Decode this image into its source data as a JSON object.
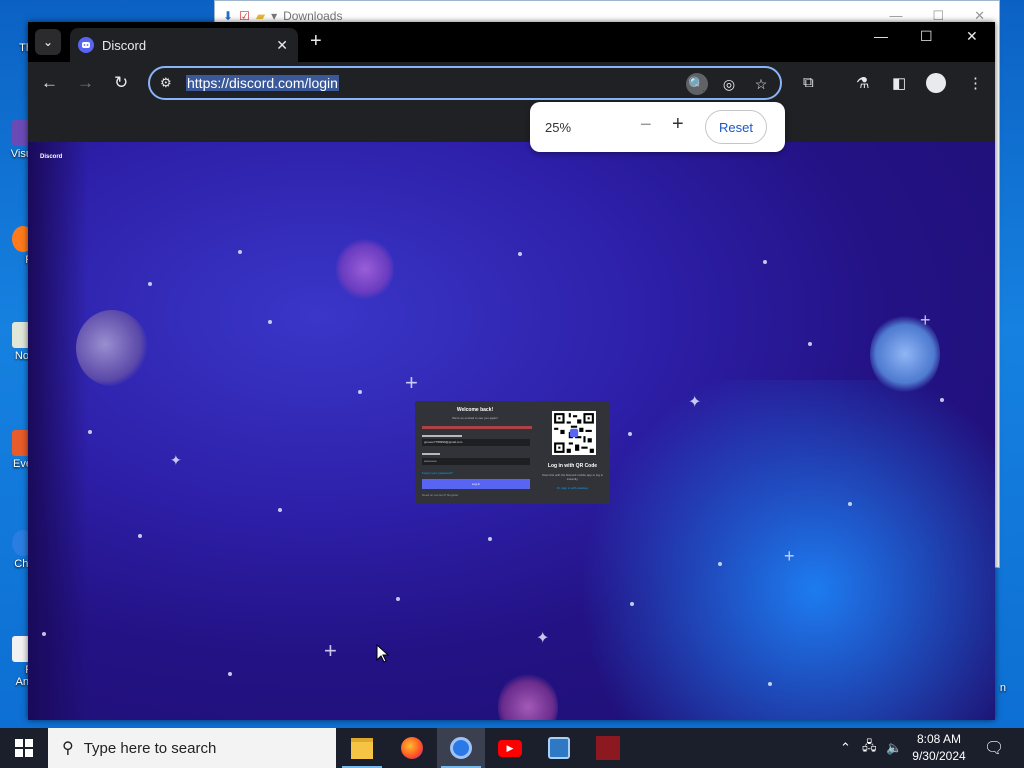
{
  "desktop": {
    "icons": [
      {
        "label": "Th"
      },
      {
        "label": "Visu"
      },
      {
        "label": "F"
      },
      {
        "label": "Not"
      },
      {
        "label": "Eve"
      },
      {
        "label": "Chr"
      },
      {
        "label": "F\nAnt"
      }
    ],
    "right_label": "n"
  },
  "background_window": {
    "title": "Downloads"
  },
  "browser": {
    "tab_title": "Discord",
    "url": "https://discord.com/login",
    "zoom_popup": {
      "level": "25%",
      "reset_label": "Reset",
      "minus": "−",
      "plus": "+"
    }
  },
  "page": {
    "logo": "Discord",
    "login": {
      "heading": "Welcome back!",
      "subheading": "We're so excited to see you again!",
      "email_value": "gmaxer7789999@gmail.com",
      "password_value": "••••••••••••",
      "forgot": "Forgot your password?",
      "login_button": "Log In",
      "register": "Need an account? Register",
      "qr_title": "Log in with QR Code",
      "qr_subtitle": "Scan this with the Discord mobile app to log in instantly.",
      "qr_link": "Or, sign in with passkey"
    }
  },
  "taskbar": {
    "search_placeholder": "Type here to search",
    "apps": [
      "file-explorer",
      "firefox",
      "chrome",
      "youtube",
      "app",
      "custom"
    ],
    "time": "8:08 AM",
    "date": "9/30/2024"
  }
}
